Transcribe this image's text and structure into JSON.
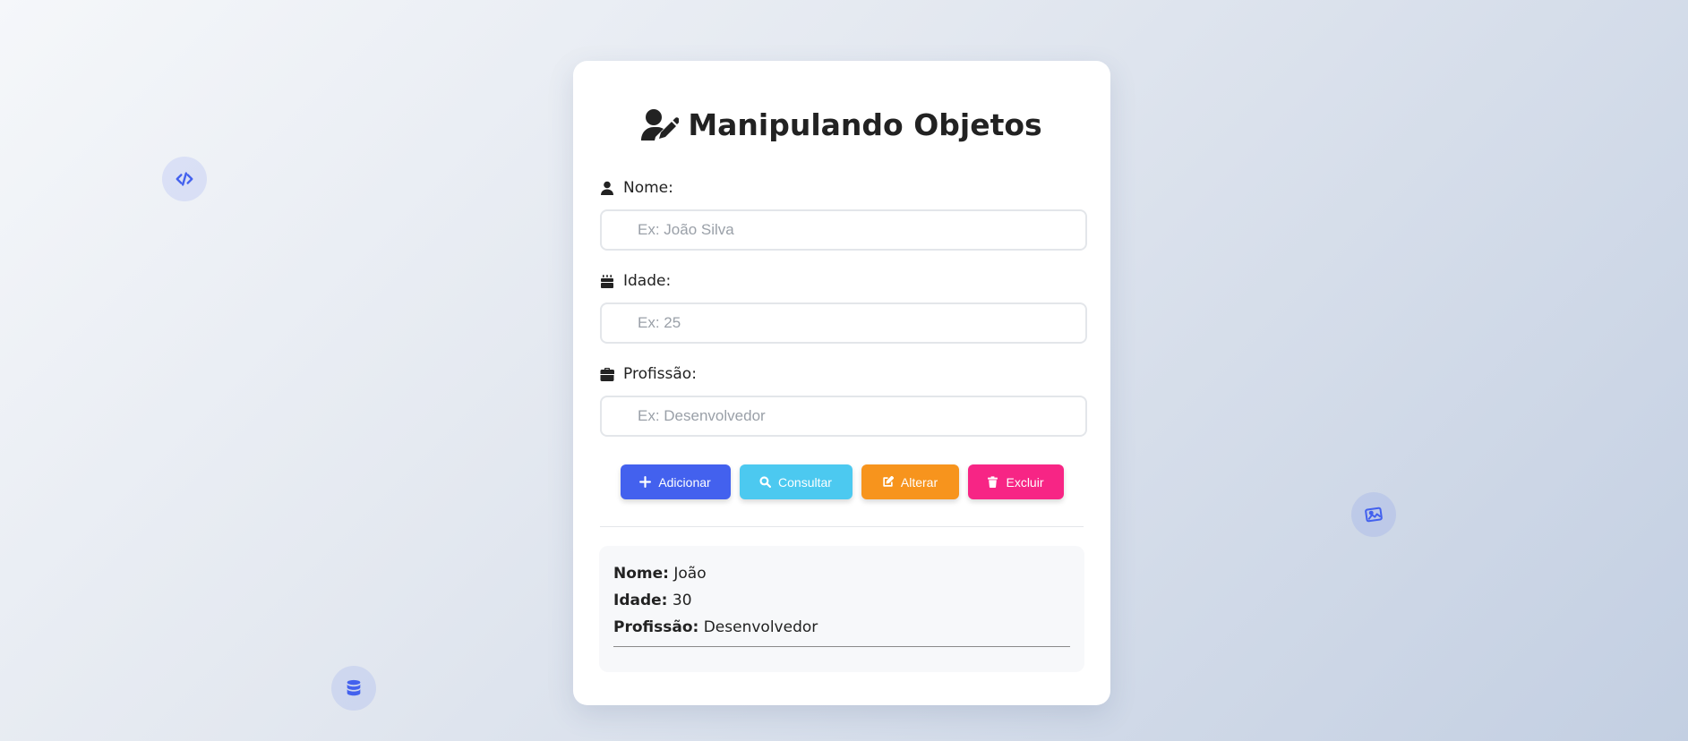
{
  "app": {
    "title": "Manipulando Objetos"
  },
  "form": {
    "fields": [
      {
        "label": "Nome:",
        "placeholder": "Ex: João Silva",
        "value": "",
        "icon": "user-icon"
      },
      {
        "label": "Idade:",
        "placeholder": "Ex: 25",
        "value": "",
        "icon": "birthday-cake-icon"
      },
      {
        "label": "Profissão:",
        "placeholder": "Ex: Desenvolvedor",
        "value": "",
        "icon": "briefcase-icon"
      }
    ]
  },
  "actions": {
    "add": {
      "label": "Adicionar",
      "icon": "plus-icon",
      "color": "#4361ee"
    },
    "query": {
      "label": "Consultar",
      "icon": "search-icon",
      "color": "#4cc9f0"
    },
    "edit": {
      "label": "Alterar",
      "icon": "edit-icon",
      "color": "#f7941d"
    },
    "delete": {
      "label": "Excluir",
      "icon": "trash-icon",
      "color": "#f72585"
    }
  },
  "result": {
    "nome_key": "Nome:",
    "nome_value": "João",
    "idade_key": "Idade:",
    "idade_value": "30",
    "profissao_key": "Profissão:",
    "profissao_value": "Desenvolvedor"
  },
  "decor": {
    "icons": [
      "code-icon",
      "database-icon",
      "image-icon"
    ]
  }
}
